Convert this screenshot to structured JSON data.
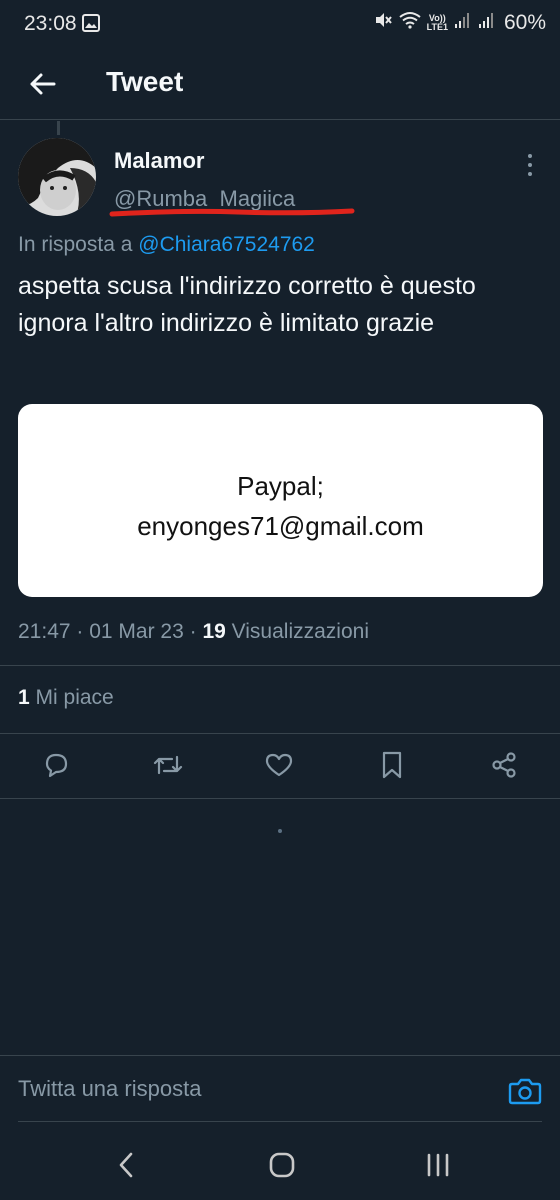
{
  "status_bar": {
    "time": "23:08",
    "lte_top": "Vo))",
    "lte_bottom": "LTE1",
    "battery": "60%"
  },
  "header": {
    "title": "Tweet"
  },
  "tweet": {
    "author_name": "Malamor",
    "author_handle": "@Rumba_Magiica",
    "reply_prefix": "In risposta a",
    "reply_to_handle": "@Chiara67524762",
    "text": "aspetta scusa l'indirizzo corretto è questo ignora l'altro indirizzo è limitato grazie",
    "media": {
      "line1": "Paypal;",
      "line2": "enyonges71@gmail.com"
    },
    "timestamp": "21:47 · 01 Mar 23 ·",
    "views_count": "19",
    "views_label": "Visualizzazioni",
    "likes_count": "1",
    "likes_label": "Mi piace"
  },
  "reply_bar": {
    "placeholder": "Twitta una risposta"
  },
  "icons": {
    "back": "arrow-left-icon",
    "more": "more-vertical-icon",
    "reply": "comment-icon",
    "retweet": "retweet-icon",
    "like": "heart-icon",
    "bookmark": "bookmark-icon",
    "share": "share-icon",
    "camera": "camera-icon"
  },
  "colors": {
    "background": "#15202b",
    "accent": "#1d9bf0",
    "secondary_text": "#8899a6",
    "annotation_red": "#e0241c"
  }
}
